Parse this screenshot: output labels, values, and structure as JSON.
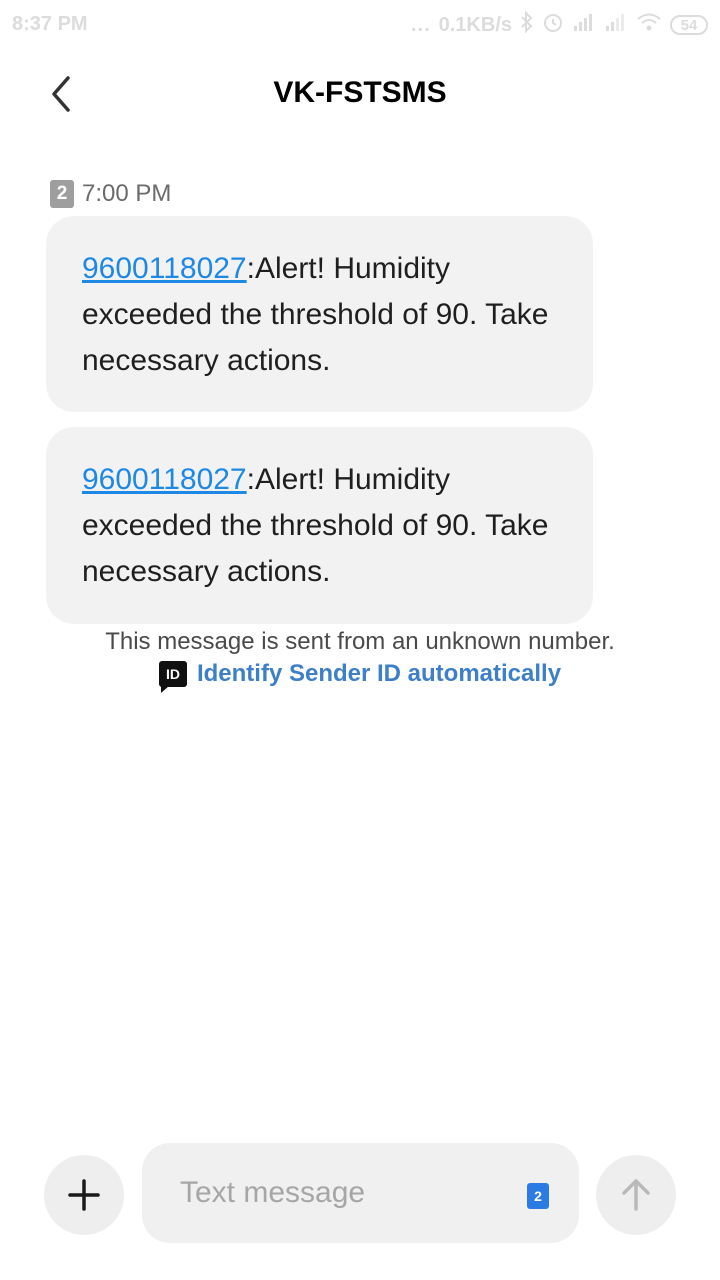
{
  "status_bar": {
    "time": "8:37 PM",
    "dots": "...",
    "speed": "0.1KB/s",
    "battery": "54"
  },
  "header": {
    "title": "VK-FSTSMS"
  },
  "conversation": {
    "sim_badge": "2",
    "timestamp": "7:00 PM",
    "messages": [
      {
        "link": "9600118027",
        "body": ":Alert! Humidity exceeded the threshold of 90. Take necessary actions."
      },
      {
        "link": "9600118027",
        "body": ":Alert! Humidity exceeded the threshold of 90. Take necessary actions."
      }
    ]
  },
  "notice": {
    "text": "This message is sent from an unknown number.",
    "id_icon": "ID",
    "link": "Identify Sender ID automatically"
  },
  "compose": {
    "placeholder": "Text message",
    "sim": "2"
  },
  "colors": {
    "link_blue": "#1e88e5",
    "identify_blue": "#3d7fc9",
    "sim_blue": "#2b7be5",
    "bubble_bg": "#f2f2f2"
  },
  "icons": {
    "back": "back-arrow-icon",
    "add": "plus-icon",
    "send": "send-arrow-icon"
  }
}
